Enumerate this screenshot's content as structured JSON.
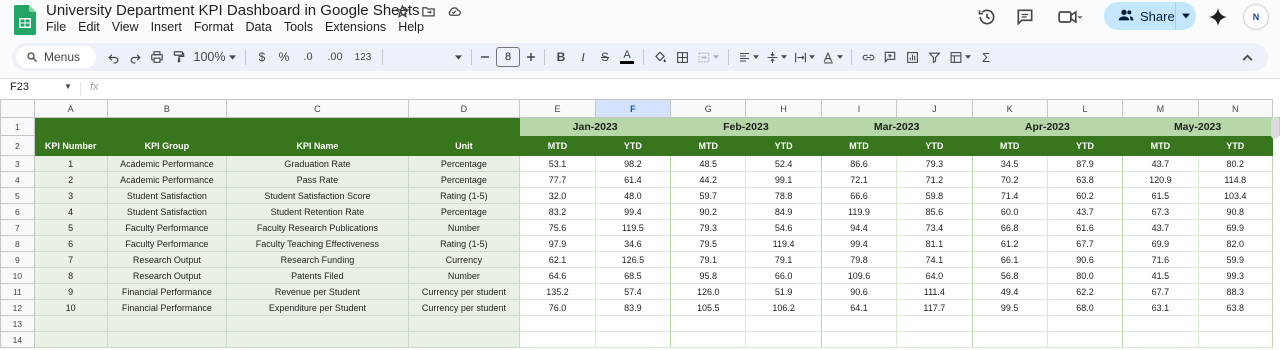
{
  "app": {
    "doc_title": "University Department KPI Dashboard in Google Sheets",
    "menus": [
      "File",
      "Edit",
      "View",
      "Insert",
      "Format",
      "Data",
      "Tools",
      "Extensions",
      "Help"
    ],
    "share_label": "Share",
    "avatar_text": "N",
    "colors": {
      "dark_green": "#38761d",
      "light_green": "#b6d7a8",
      "pale_green": "#e8f1e4",
      "share_bg": "#c2e7ff"
    }
  },
  "toolbar": {
    "menus_label": "Menus",
    "zoom": "100%",
    "currency": "$",
    "percent": "%",
    "dec_decrease": ".0",
    "dec_increase": ".00",
    "number_format": "123",
    "font_size": "8"
  },
  "formula_bar": {
    "cell_ref": "F23",
    "fx": "fx"
  },
  "grid": {
    "columns": [
      "A",
      "B",
      "C",
      "D",
      "E",
      "F",
      "G",
      "H",
      "I",
      "J",
      "K",
      "L",
      "M",
      "N"
    ],
    "row_numbers": [
      "1",
      "2",
      "3",
      "4",
      "5",
      "6",
      "7",
      "8",
      "9",
      "10",
      "11",
      "12",
      "13",
      "14"
    ],
    "months": [
      "Jan-2023",
      "Feb-2023",
      "Mar-2023",
      "Apr-2023",
      "May-2023"
    ],
    "headers": {
      "kpi_number": "KPI Number",
      "kpi_group": "KPI Group",
      "kpi_name": "KPI Name",
      "unit": "Unit",
      "mtd": "MTD",
      "ytd": "YTD"
    },
    "rows": [
      {
        "num": "1",
        "group": "Academic Performance",
        "name": "Graduation Rate",
        "unit": "Percentage",
        "values": [
          "53.1",
          "98.2",
          "48.5",
          "52.4",
          "86.6",
          "79.3",
          "34.5",
          "87.9",
          "43.7",
          "80.2"
        ]
      },
      {
        "num": "2",
        "group": "Academic Performance",
        "name": "Pass Rate",
        "unit": "Percentage",
        "values": [
          "77.7",
          "61.4",
          "44.2",
          "99.1",
          "72.1",
          "71.2",
          "70.2",
          "63.8",
          "120.9",
          "114.8"
        ]
      },
      {
        "num": "3",
        "group": "Student Satisfaction",
        "name": "Student Satisfaction Score",
        "unit": "Rating (1-5)",
        "values": [
          "32.0",
          "48.0",
          "59.7",
          "78.8",
          "66.6",
          "59.8",
          "71.4",
          "60.2",
          "61.5",
          "103.4"
        ]
      },
      {
        "num": "4",
        "group": "Student Satisfaction",
        "name": "Student Retention Rate",
        "unit": "Percentage",
        "values": [
          "83.2",
          "99.4",
          "90.2",
          "84.9",
          "119.9",
          "85.6",
          "60.0",
          "43.7",
          "67.3",
          "90.8"
        ]
      },
      {
        "num": "5",
        "group": "Faculty Performance",
        "name": "Faculty Research Publications",
        "unit": "Number",
        "values": [
          "75.6",
          "119.5",
          "79.3",
          "54.6",
          "94.4",
          "73.4",
          "66.8",
          "61.6",
          "43.7",
          "69.9"
        ]
      },
      {
        "num": "6",
        "group": "Faculty Performance",
        "name": "Faculty Teaching Effectiveness",
        "unit": "Rating (1-5)",
        "values": [
          "97.9",
          "34.6",
          "79.5",
          "119.4",
          "99.4",
          "81.1",
          "61.2",
          "67.7",
          "69.9",
          "82.0"
        ]
      },
      {
        "num": "7",
        "group": "Research Output",
        "name": "Research Funding",
        "unit": "Currency",
        "values": [
          "62.1",
          "126.5",
          "79.1",
          "79.1",
          "79.8",
          "74.1",
          "66.1",
          "90.6",
          "71.6",
          "59.9"
        ]
      },
      {
        "num": "8",
        "group": "Research Output",
        "name": "Patents Filed",
        "unit": "Number",
        "values": [
          "64.6",
          "68.5",
          "95.8",
          "66.0",
          "109.6",
          "64.0",
          "56.8",
          "80.0",
          "41.5",
          "99.3"
        ]
      },
      {
        "num": "9",
        "group": "Financial Performance",
        "name": "Revenue per Student",
        "unit": "Currency per student",
        "values": [
          "135.2",
          "57.4",
          "126.0",
          "51.9",
          "90.6",
          "111.4",
          "49.4",
          "62.2",
          "67.7",
          "88.3"
        ]
      },
      {
        "num": "10",
        "group": "Financial Performance",
        "name": "Expenditure per Student",
        "unit": "Currency per student",
        "values": [
          "76.0",
          "83.9",
          "105.5",
          "106.2",
          "64.1",
          "117.7",
          "99.5",
          "68.0",
          "63.1",
          "63.8"
        ]
      }
    ]
  }
}
